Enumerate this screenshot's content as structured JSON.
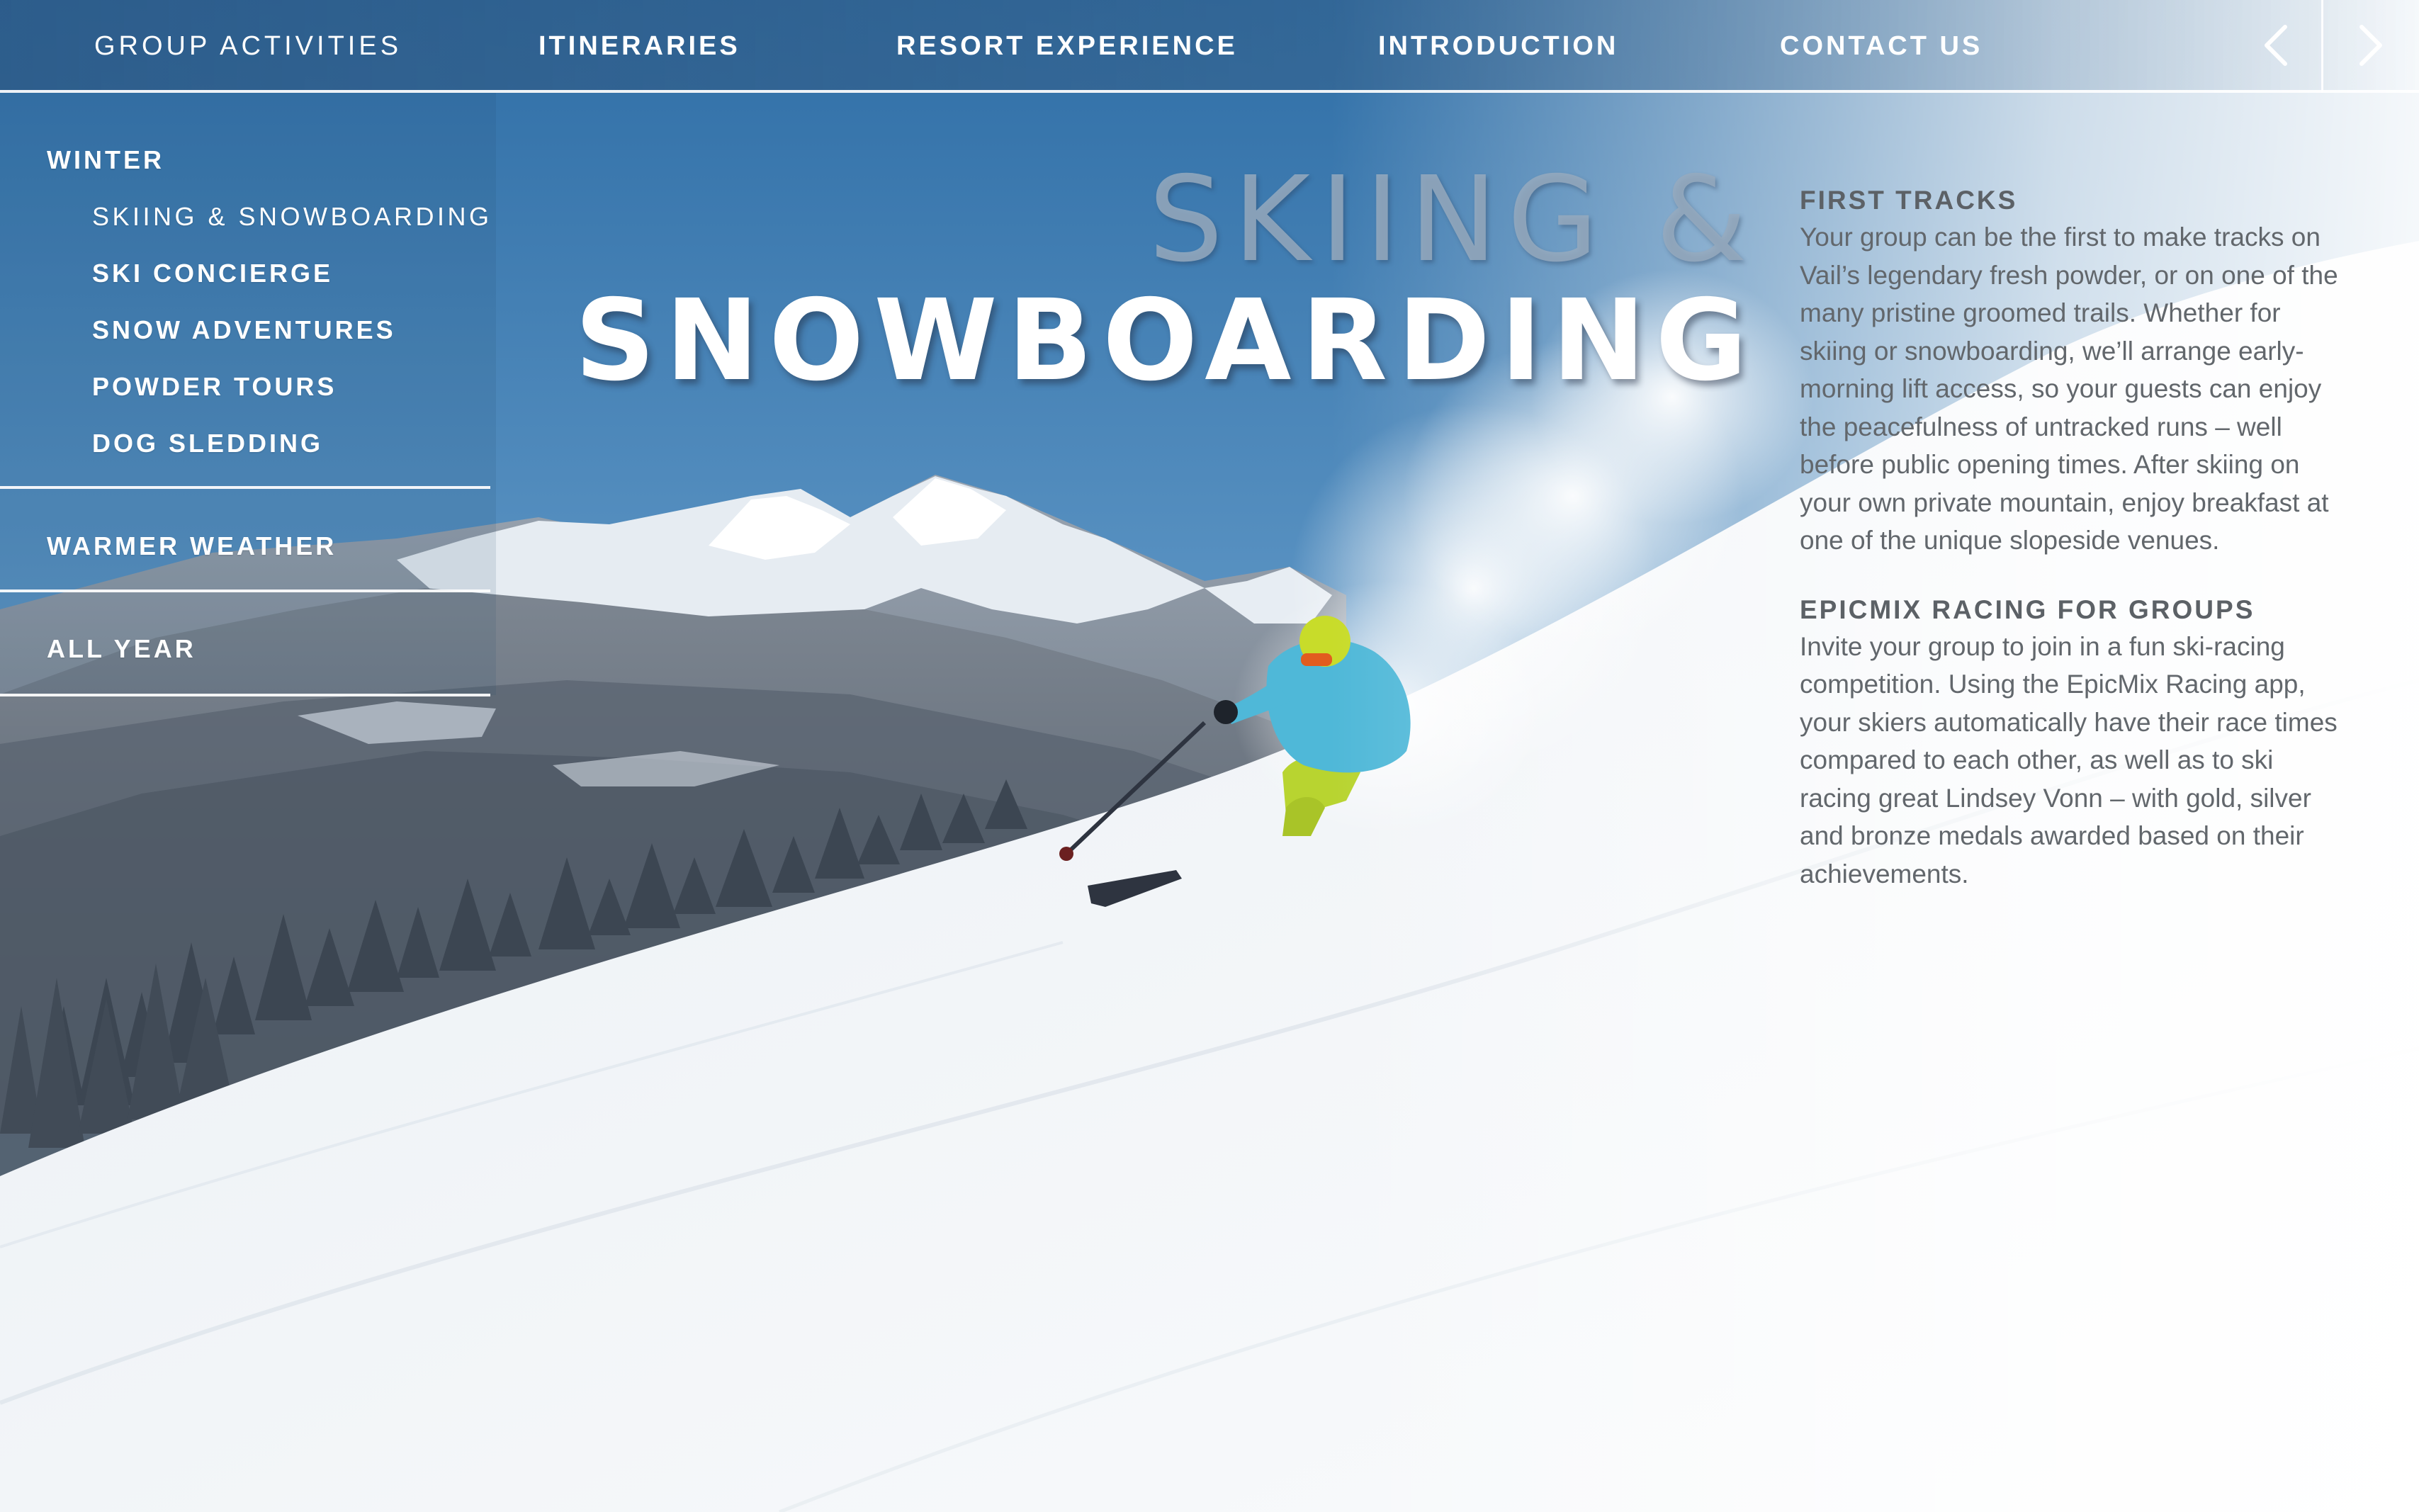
{
  "nav": {
    "items": [
      {
        "label": "GROUP ACTIVITIES"
      },
      {
        "label": "ITINERARIES"
      },
      {
        "label": "RESORT EXPERIENCE"
      },
      {
        "label": "INTRODUCTION"
      },
      {
        "label": "CONTACT US"
      }
    ],
    "prev_icon": "chevron-left-icon",
    "next_icon": "chevron-right-icon"
  },
  "sidebar": {
    "sections": [
      {
        "label": "WINTER",
        "items": [
          {
            "label": "SKIING & SNOWBOARDING",
            "active": true
          },
          {
            "label": "SKI CONCIERGE"
          },
          {
            "label": "SNOW ADVENTURES"
          },
          {
            "label": "POWDER TOURS"
          },
          {
            "label": "DOG SLEDDING"
          }
        ]
      },
      {
        "label": "WARMER WEATHER"
      },
      {
        "label": "ALL YEAR"
      }
    ]
  },
  "hero": {
    "title_line1": "SKIING &",
    "title_line2": "SNOWBOARDING"
  },
  "content": {
    "sections": [
      {
        "heading": "FIRST TRACKS",
        "body": "Your group can be the first to make tracks on Vail’s legendary fresh powder, or on one of the many pristine groomed trails. Whether for skiing or snowboarding, we’ll arrange early-morning lift access, so your guests can enjoy the peacefulness of untracked runs – well before public opening times. After skiing on your own private mountain, enjoy breakfast at one of the unique slopeside venues."
      },
      {
        "heading": "EPICMIX RACING FOR GROUPS",
        "body": "Invite your group to join in a fun ski-racing competition. Using the EpicMix Racing app, your skiers automatically have their race times compared to each other, as well as to ski racing great Lindsey Vonn – with gold, silver and bronze medals awarded based on their achievements."
      }
    ]
  },
  "colors": {
    "nav_bg": "#2c5884",
    "sky_top": "#2f6ea6",
    "sky_bottom": "#9cc6e6",
    "snow": "#f4f6f8",
    "body_text": "#62676c",
    "jacket": "#4fb8d8",
    "pants": "#b8d430"
  }
}
